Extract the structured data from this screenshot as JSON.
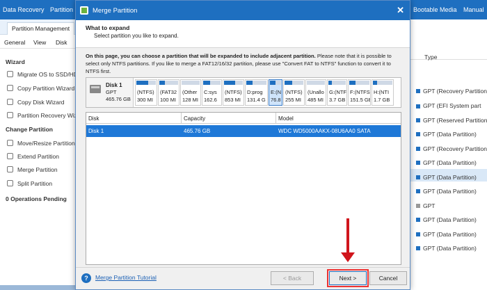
{
  "app": {
    "menu": [
      "Data Recovery",
      "Partition R",
      "Bootable Media",
      "Manual"
    ],
    "ribbon_tab": "Partition Management",
    "toolbar": [
      "General",
      "View",
      "Disk"
    ],
    "sidebar": {
      "wizard_header": "Wizard",
      "wizard_items": [
        "Migrate OS to SSD/HD",
        "Copy Partition Wizard",
        "Copy Disk Wizard",
        "Partition Recovery Wiz"
      ],
      "change_header": "Change Partition",
      "change_items": [
        "Move/Resize Partition",
        "Extend Partition",
        "Merge Partition",
        "Split Partition"
      ],
      "pending": "0 Operations Pending"
    },
    "right_panel": {
      "type_header": "Type",
      "rows": [
        "GPT (Recovery Partition)",
        "GPT (EFI System part",
        "GPT (Reserved Partition)",
        "GPT (Data Partition)",
        "GPT (Recovery Partition)",
        "GPT (Data Partition)",
        "GPT (Data Partition)",
        "GPT (Data Partition)",
        "GPT",
        "GPT (Data Partition)",
        "GPT (Data Partition)",
        "GPT (Data Partition)"
      ]
    }
  },
  "dialog": {
    "title": "Merge Partition",
    "close_glyph": "✕",
    "heading": "What to expand",
    "subheading": "Select partition you like to expand.",
    "description_bold": "On this page, you can choose a partition that will be expanded to include adjacent partition.",
    "description_rest": " Please note that it is possible to select only NTFS partitions. If you like to merge a FAT12/16/32 partition, please use \"Convert FAT to NTFS\" function to convert it to NTFS first.",
    "disk": {
      "name": "Disk 1",
      "type": "GPT",
      "size": "465.76 GB"
    },
    "partitions": [
      {
        "l1": "(NTFS)",
        "l2": "300 MI",
        "fill": 0.6
      },
      {
        "l1": "(FAT32",
        "l2": "100 MI",
        "fill": 0.3
      },
      {
        "l1": "(Other",
        "l2": "128 MI",
        "fill": 0.0
      },
      {
        "l1": "C:sys",
        "l2": "162.6",
        "fill": 0.4
      },
      {
        "l1": "(NTFS)",
        "l2": "853 MI",
        "fill": 0.6
      },
      {
        "l1": "D:prog",
        "l2": "131.4 G",
        "fill": 0.3
      },
      {
        "l1": "E:(N",
        "l2": "76.8",
        "fill": 0.5,
        "selected": true
      },
      {
        "l1": "(NTFS)",
        "l2": "255 MI",
        "fill": 0.4
      },
      {
        "l1": "(Unallo",
        "l2": "485 MI",
        "fill": 0.0
      },
      {
        "l1": "G:(NTF",
        "l2": "3.7 GB",
        "fill": 0.2
      },
      {
        "l1": "F:(NTFS",
        "l2": "151.5 GB",
        "fill": 0.3
      },
      {
        "l1": "H:(NTI",
        "l2": "1.7 GB",
        "fill": 0.2
      }
    ],
    "table": {
      "columns": [
        "Disk",
        "Capacity",
        "Model"
      ],
      "rows": [
        {
          "disk": "Disk 1",
          "capacity": "465.76 GB",
          "model": "WDC WD5000AAKX-08U6AA0 SATA"
        }
      ]
    },
    "footer": {
      "help_glyph": "?",
      "tutorial_link": "Merge Partition Tutorial",
      "back_label": "< Back",
      "next_label": "Next >",
      "cancel_label": "Cancel"
    }
  },
  "colors": {
    "title_bar": "#1e6fc0",
    "selection": "#1e78d7",
    "annotation_red": "#d0151c"
  }
}
